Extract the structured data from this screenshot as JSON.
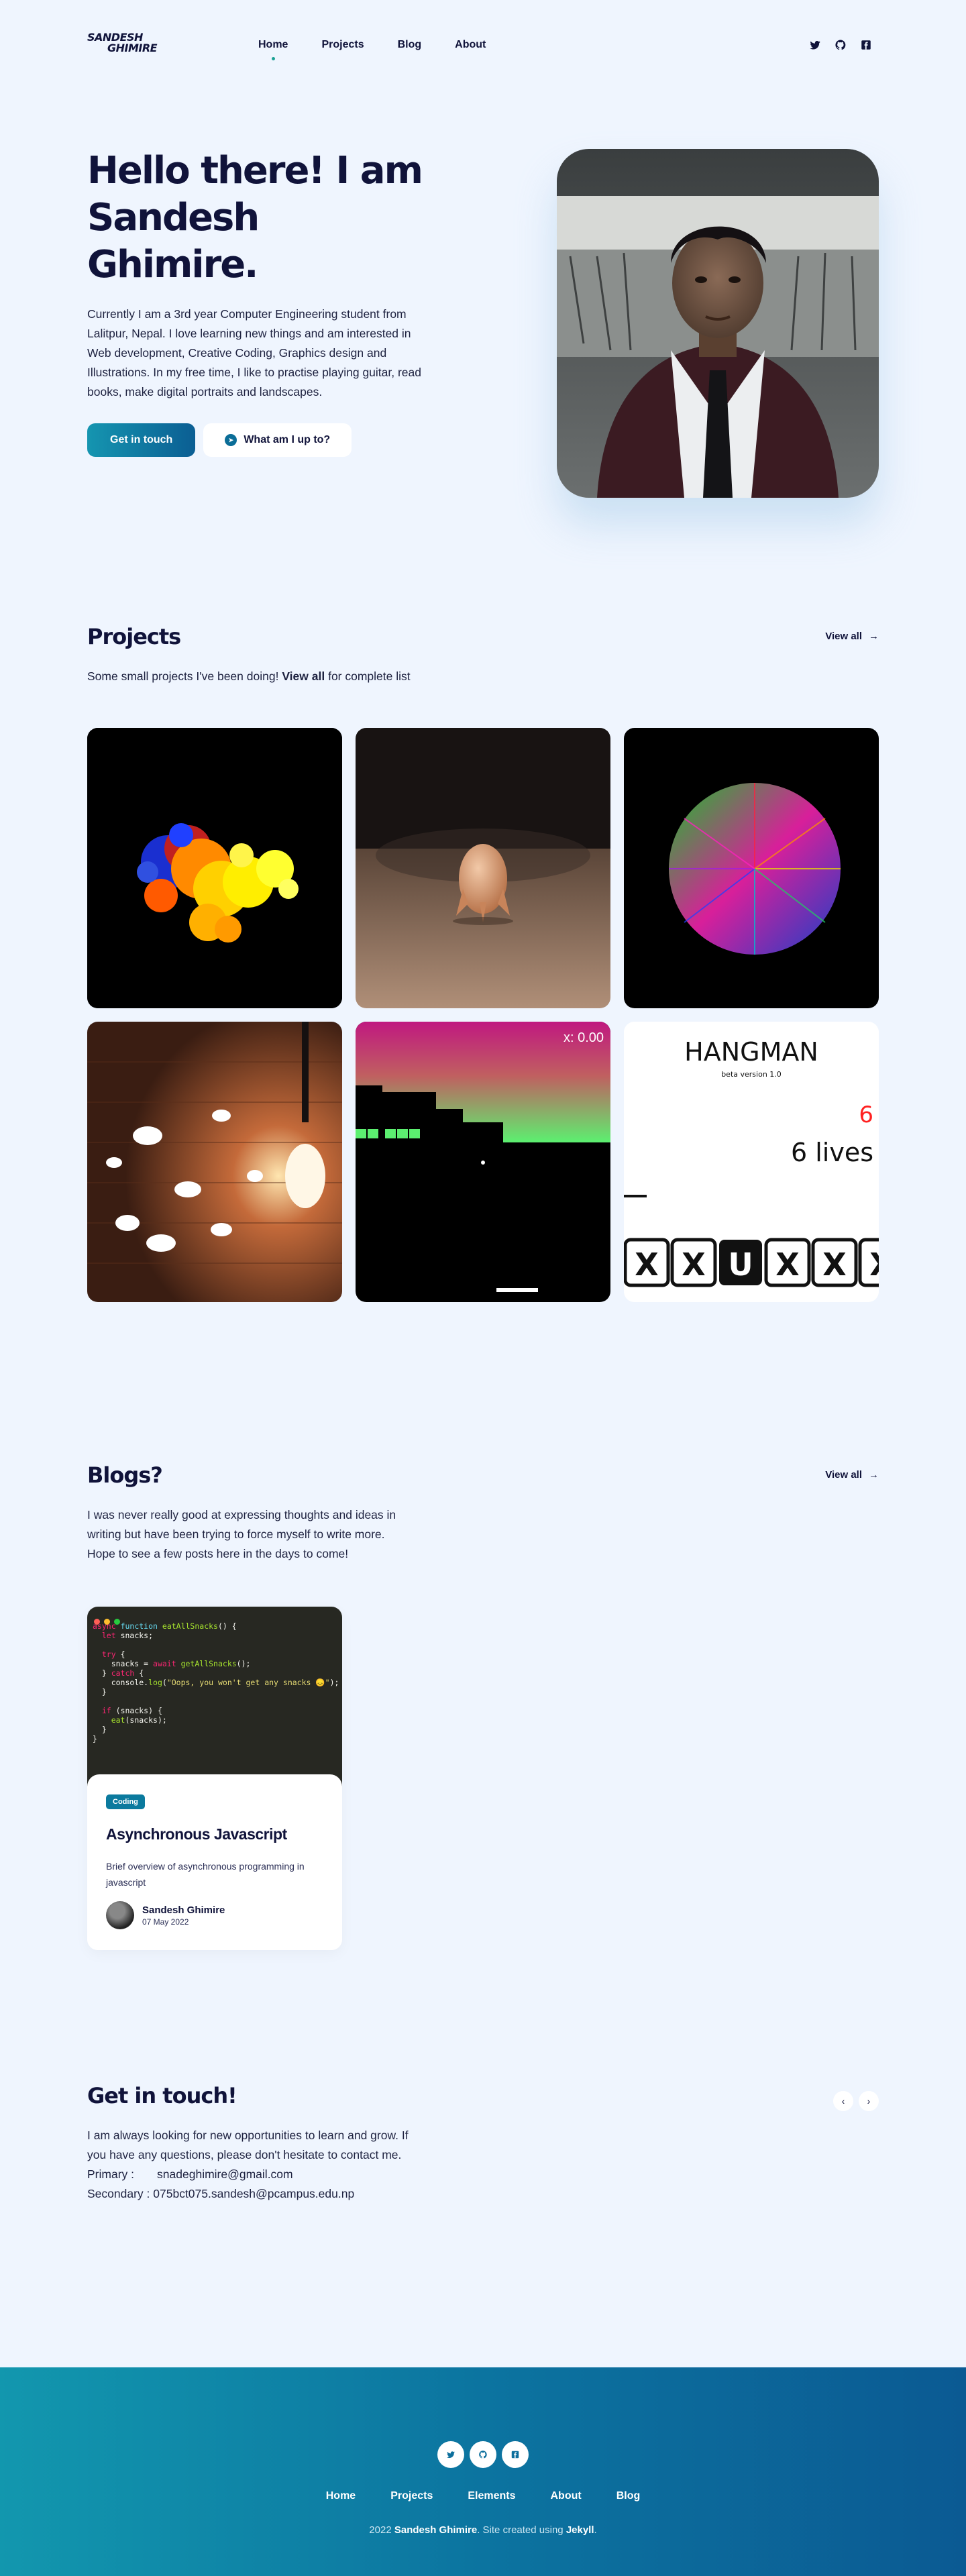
{
  "header": {
    "logo_line1": "SANDESH",
    "logo_line2": "GHIMIRE",
    "nav": [
      "Home",
      "Projects",
      "Blog",
      "About"
    ],
    "social_icons": [
      "twitter-icon",
      "github-icon",
      "facebook-icon"
    ]
  },
  "hero": {
    "title": "Hello there! I am Sandesh Ghimire.",
    "description": "Currently I am a 3rd year Computer Engineering student from Lalitpur, Nepal. I love learning new things and am interested in Web development, Creative Coding, Graphics design and Illustrations. In my free time, I like to practise playing guitar, read books, make digital portraits and landscapes.",
    "primary_button": "Get in touch",
    "secondary_button": "What am I up to?"
  },
  "projects": {
    "title": "Projects",
    "view_all": "View all",
    "desc_before": "Some small projects I've been doing!",
    "desc_link": "View all",
    "desc_after": "for complete list",
    "breakout_score": "x: 0.00",
    "hangman_title": "HANGMAN",
    "hangman_version": "beta version 1.0",
    "hangman_number": "6",
    "hangman_lives": "6 lives",
    "hangman_letter": "U"
  },
  "blogs": {
    "title": "Blogs?",
    "view_all": "View all",
    "description": "I was never really good at expressing thoughts and ideas in writing but have been trying to force myself to write more. Hope to see a few posts here in the days to come!",
    "post": {
      "badge": "Coding",
      "title": "Asynchronous Javascript",
      "excerpt": "Brief overview of asynchronous programming in javascript",
      "author": "Sandesh Ghimire",
      "date": "07 May 2022"
    }
  },
  "contact": {
    "title": "Get in touch!",
    "description": "I am always looking for new opportunities to learn and grow. If you have any questions, please don't hesitate to contact me.",
    "primary_label": "Primary :",
    "primary_email": "snadeghimire@gmail.com",
    "secondary_label": "Secondary :",
    "secondary_email": "075bct075.sandesh@pcampus.edu.np"
  },
  "footer": {
    "nav": [
      "Home",
      "Projects",
      "Elements",
      "About",
      "Blog"
    ],
    "copy_year": "2022",
    "copy_name": "Sandesh Ghimire",
    "copy_mid": ". Site created using",
    "copy_tool": "Jekyll",
    "copy_end": "."
  },
  "colors": {
    "background": "#eff5fe",
    "text_dark": "#10133a",
    "accent_teal": "#1595b0",
    "accent_blue": "#0b5e93"
  }
}
